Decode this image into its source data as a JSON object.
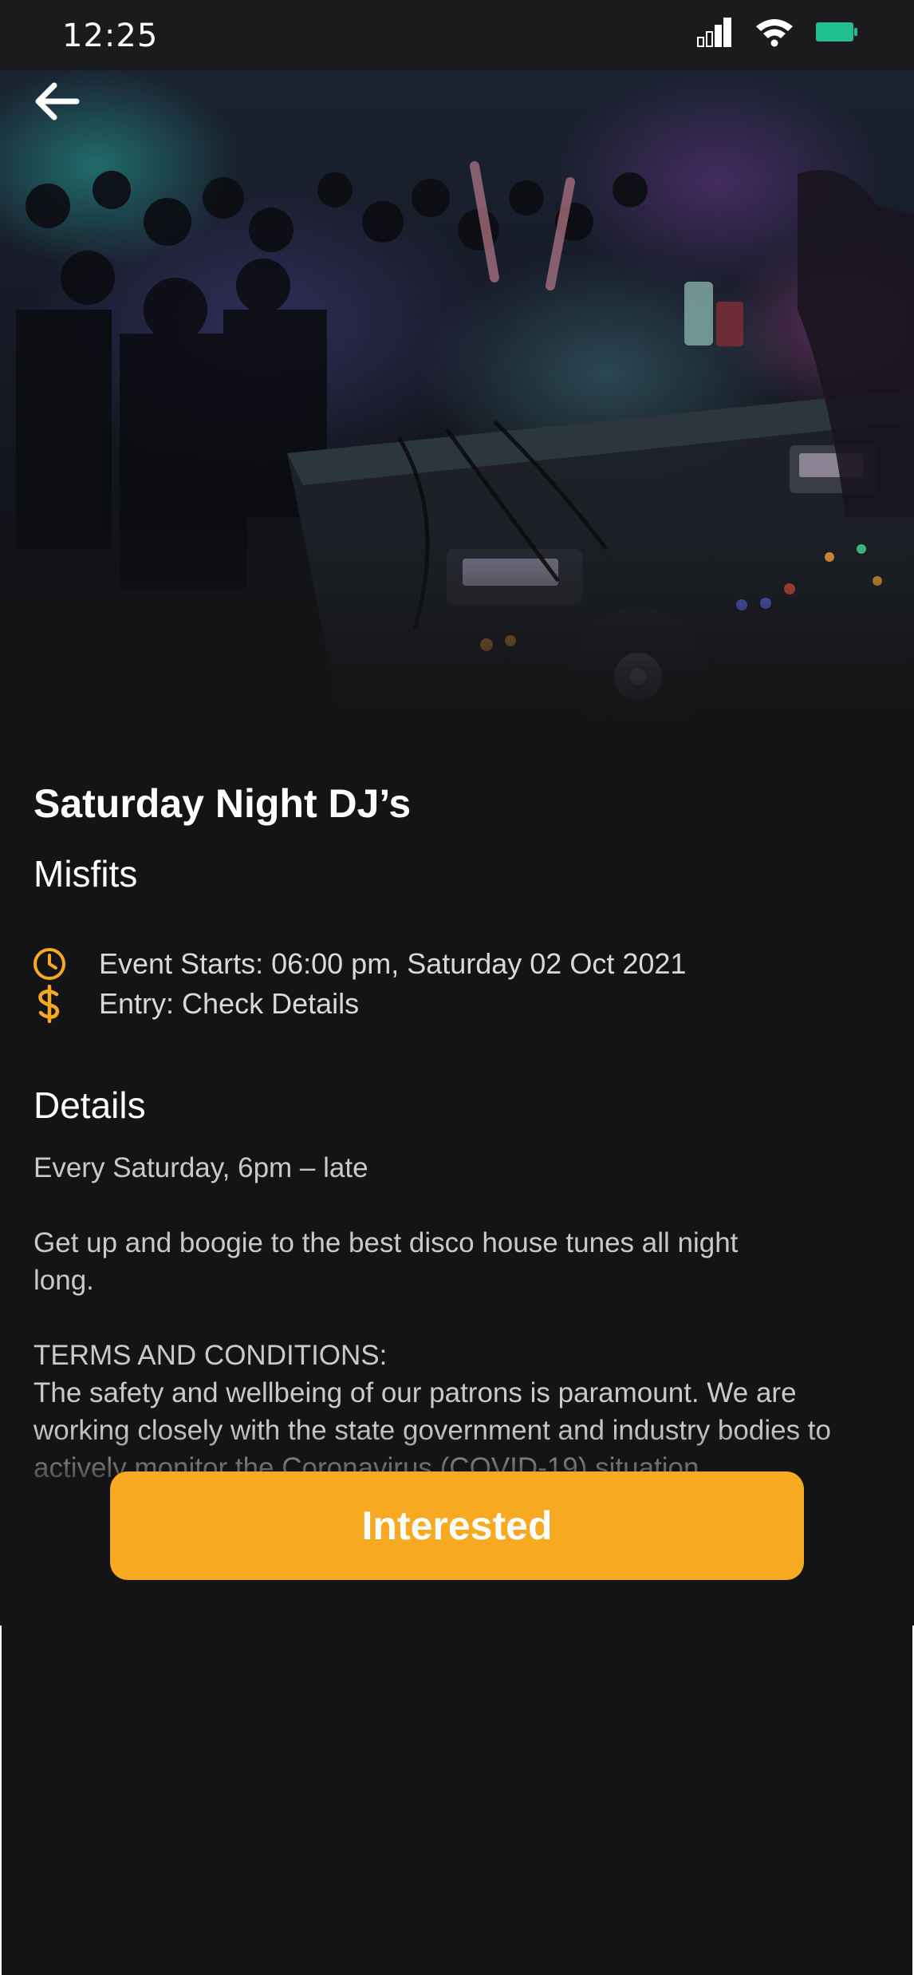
{
  "status_bar": {
    "time": "12:25",
    "icons": [
      "signal-icon",
      "wifi-icon",
      "battery-icon"
    ],
    "battery_color": "#1fbf8f"
  },
  "hero": {
    "image_description": "DJ booth with crowd in nightclub",
    "back_icon": "arrow-left-icon"
  },
  "event": {
    "title": "Saturday Night DJ’s",
    "venue": "Misfits",
    "starts_label": "Event Starts: 06:00 pm, Saturday 02 Oct 2021",
    "entry_label": "Entry: Check Details",
    "icon_color": "#f8a922"
  },
  "details": {
    "heading": "Details",
    "schedule": "Every Saturday, 6pm – late",
    "description": "Get up and boogie to the best disco house tunes all night long.",
    "terms_title": "TERMS AND CONDITIONS:",
    "terms_text": "The safety and wellbeing of our patrons is paramount. We are working closely with the state government and industry bodies to actively monitor the Coronavirus (COVID-19) situation"
  },
  "cta": {
    "label": "Interested",
    "color": "#f8a922"
  }
}
